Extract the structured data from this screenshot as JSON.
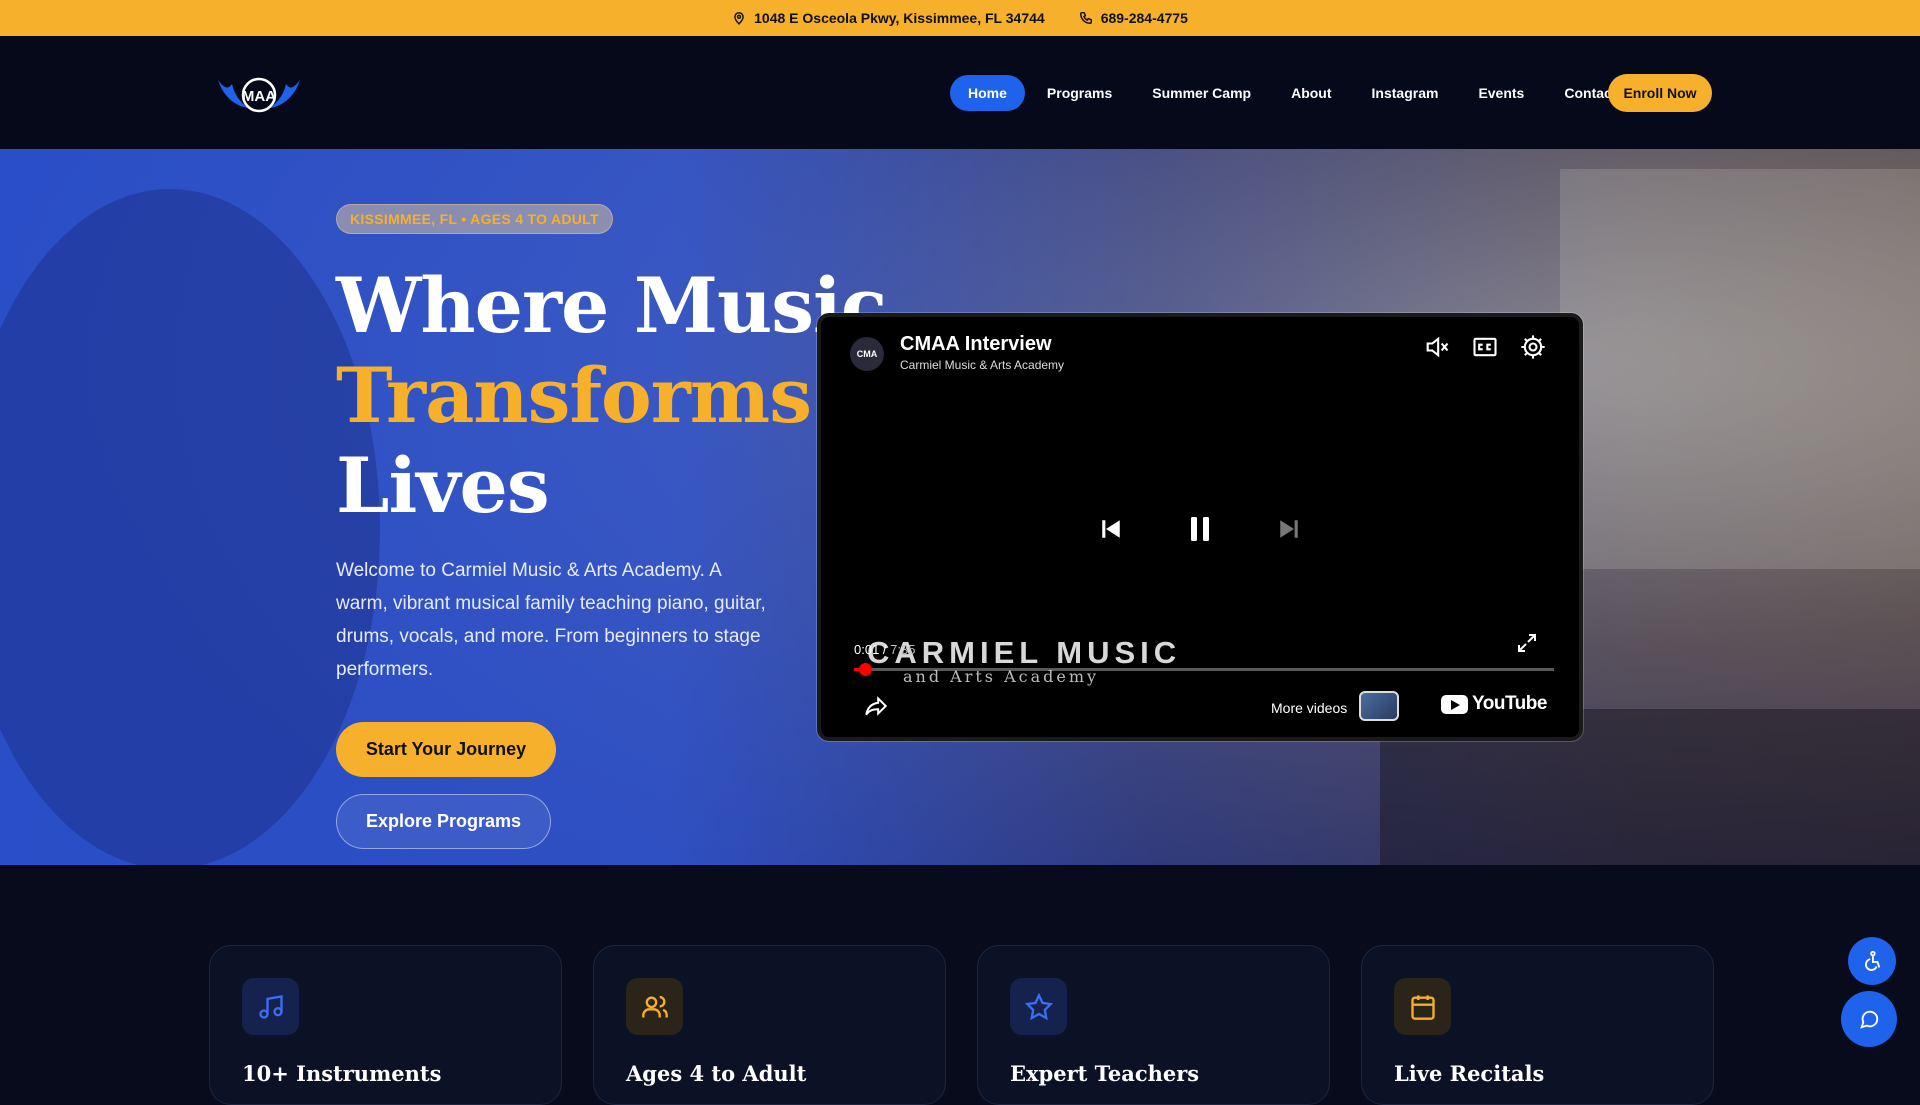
{
  "topbar": {
    "address": "1048 E Osceola Pkwy, Kissimmee, FL 34744",
    "phone": "689-284-4775"
  },
  "header": {
    "logo_text": "MAA",
    "nav": [
      {
        "label": "Home",
        "active": true
      },
      {
        "label": "Programs"
      },
      {
        "label": "Summer Camp"
      },
      {
        "label": "About"
      },
      {
        "label": "Instagram"
      },
      {
        "label": "Events"
      },
      {
        "label": "Contact"
      }
    ],
    "cta": "Enroll Now"
  },
  "hero": {
    "badge": "KISSIMMEE, FL • AGES 4 TO ADULT",
    "headline": [
      "Where Music",
      "Transforms",
      "Lives"
    ],
    "intro": "Welcome to Carmiel Music & Arts Academy. A warm, vibrant musical family teaching piano, guitar, drums, vocals, and more. From beginners to stage performers.",
    "primary_button": "Start Your Journey",
    "secondary_button": "Explore Programs"
  },
  "video": {
    "title": "CMAA Interview",
    "channel": "Carmiel Music & Arts Academy",
    "avatar_text": "CMA",
    "current_time": "0:01",
    "duration": "7:35",
    "progress_fraction": 0.002,
    "watermark_main": "CARMIEL MUSIC",
    "watermark_sub": "and Arts Academy",
    "more_videos": "More videos",
    "youtube": "YouTube"
  },
  "features": [
    {
      "title": "10+ Instruments",
      "icon": "music-note-icon",
      "color": "#3b6ef5"
    },
    {
      "title": "Ages 4 to Adult",
      "icon": "users-icon",
      "color": "#f6b02b"
    },
    {
      "title": "Expert Teachers",
      "icon": "star-icon",
      "color": "#3b6ef5"
    },
    {
      "title": "Live Recitals",
      "icon": "calendar-icon",
      "color": "#f6b02b"
    }
  ],
  "colors": {
    "accent_yellow": "#f6b02b",
    "accent_blue": "#1f62ec",
    "background": "#070b1c"
  }
}
